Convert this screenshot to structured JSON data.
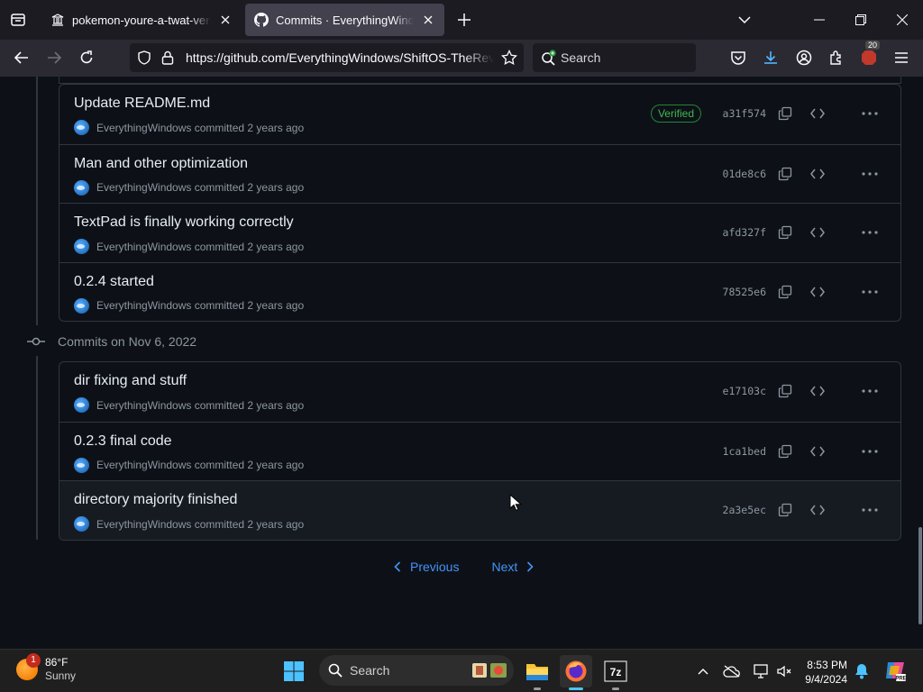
{
  "browser": {
    "tabs": [
      {
        "title": "pokemon-youre-a-twat-version",
        "active": false
      },
      {
        "title": "Commits · EverythingWindows",
        "active": true
      }
    ],
    "url": "https://github.com/EverythingWindows/ShiftOS-TheRevival/commits",
    "search_placeholder": "Search",
    "extensions_badge": "20"
  },
  "groups": [
    {
      "heading": "",
      "commits": [
        {
          "title": "Update README.md",
          "author": "EverythingWindows",
          "action": "committed",
          "time": "2 years ago",
          "verified": "Verified",
          "sha": "a31f574"
        },
        {
          "title": "Man and other optimization",
          "author": "EverythingWindows",
          "action": "committed",
          "time": "2 years ago",
          "sha": "01de8c6"
        },
        {
          "title": "TextPad is finally working correctly",
          "author": "EverythingWindows",
          "action": "committed",
          "time": "2 years ago",
          "sha": "afd327f"
        },
        {
          "title": "0.2.4 started",
          "author": "EverythingWindows",
          "action": "committed",
          "time": "2 years ago",
          "sha": "78525e6"
        }
      ]
    },
    {
      "heading": "Commits on Nov 6, 2022",
      "commits": [
        {
          "title": "dir fixing and stuff",
          "author": "EverythingWindows",
          "action": "committed",
          "time": "2 years ago",
          "sha": "e17103c"
        },
        {
          "title": "0.2.3 final code",
          "author": "EverythingWindows",
          "action": "committed",
          "time": "2 years ago",
          "sha": "1ca1bed"
        },
        {
          "title": "directory majority finished",
          "author": "EverythingWindows",
          "action": "committed",
          "time": "2 years ago",
          "sha": "2a3e5ec"
        }
      ]
    }
  ],
  "pagination": {
    "previous": "Previous",
    "next": "Next"
  },
  "taskbar": {
    "weather_temp": "86°F",
    "weather_condition": "Sunny",
    "weather_badge": "1",
    "search_placeholder": "Search",
    "time": "8:53 PM",
    "date": "9/4/2024"
  },
  "colors": {
    "accent_link": "#4493f8",
    "verified_green": "#3fb950",
    "page_bg": "#0d1117",
    "border": "#30363d"
  }
}
